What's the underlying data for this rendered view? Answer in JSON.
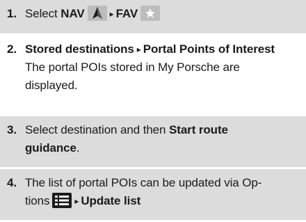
{
  "steps": [
    {
      "number": "1.",
      "select": "Select",
      "nav": "NAV",
      "nav_icon": "navigation-arrow-icon",
      "arrow": "▸",
      "fav": "FAV",
      "fav_icon": "star-icon"
    },
    {
      "number": "2.",
      "stored": "Stored destinations",
      "arrow": "▸",
      "portal": "Portal Points of Interest",
      "desc_line1": "The portal POIs stored in My Porsche are",
      "desc_line2": "displayed."
    },
    {
      "number": "3.",
      "text": "Select destination and then",
      "bold1": "Start route",
      "bold2": "guidance",
      "period": "."
    },
    {
      "number": "4.",
      "line1": "The list of portal POIs can be updated via Op-",
      "line2": "tions",
      "options_icon": "options-list-icon",
      "arrow": "▸",
      "update": "Update list"
    }
  ],
  "colors": {
    "shade": "#dcdcdc",
    "icon_dark": "#1a1a1a",
    "icon_light": "#bdbdbd"
  }
}
